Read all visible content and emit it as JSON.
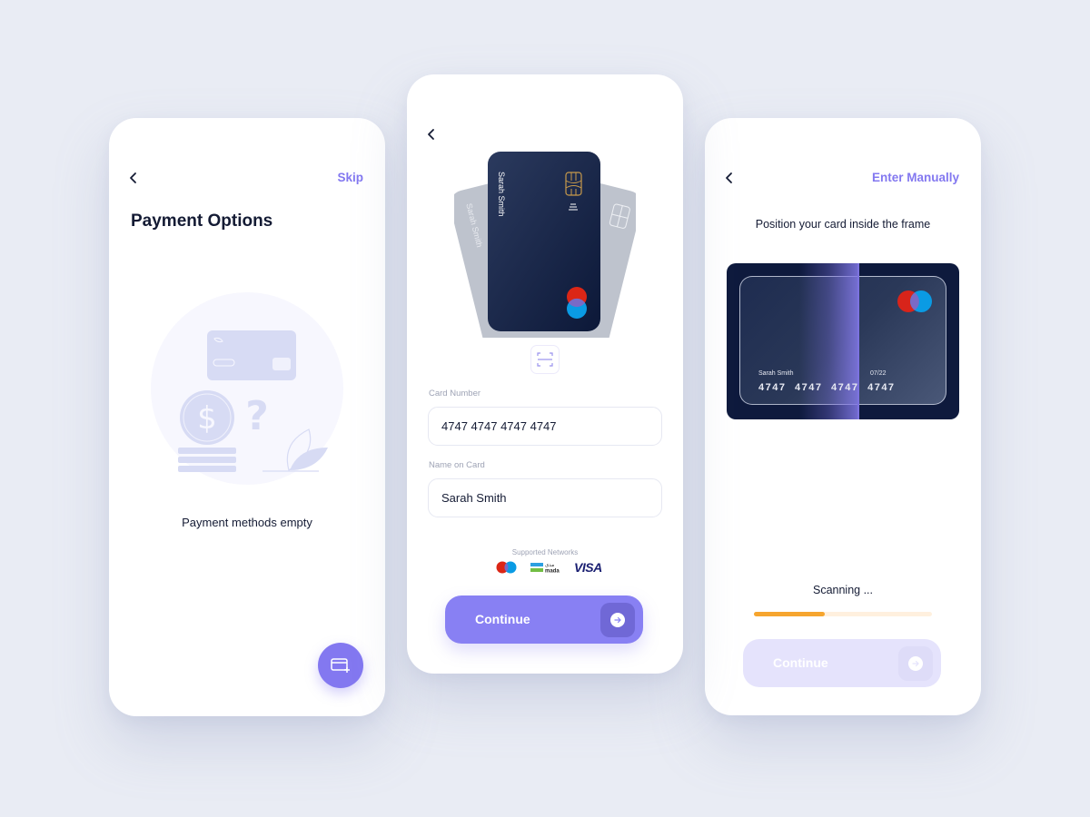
{
  "colors": {
    "background": "#E9ECF4",
    "accent": "#8378F0",
    "text_primary": "#141B34",
    "text_muted": "#9EA3B5",
    "progress": "#F6A52E",
    "card_navy": "#0E1A3D"
  },
  "screen1": {
    "back_icon": "chevron-left-icon",
    "skip_label": "Skip",
    "title": "Payment Options",
    "illustration": "empty-wallet-illustration",
    "empty_message": "Payment methods empty",
    "fab_icon": "add-card-icon"
  },
  "screen2": {
    "back_icon": "chevron-left-icon",
    "cards": [
      {
        "holder": "Sarah Smith",
        "style": "back-left"
      },
      {
        "holder": "Sarah Smith",
        "style": "front"
      },
      {
        "holder": "",
        "style": "back-right"
      }
    ],
    "scan_icon": "scan-card-icon",
    "card_number_label": "Card Number",
    "card_number_value": "4747  4747  4747  4747",
    "name_label": "Name on Card",
    "name_value": "Sarah Smith",
    "networks_label": "Supported Networks",
    "networks": [
      "Maestro",
      "mada",
      "VISA"
    ],
    "mada_arabic": "مدى",
    "continue_label": "Continue"
  },
  "screen3": {
    "back_icon": "chevron-left-icon",
    "enter_manually_label": "Enter Manually",
    "instruction": "Position your card inside the frame",
    "card_holder": "Sarah Smith",
    "card_expiry": "07/22",
    "card_number": "4747 4747 4747 4747",
    "scanning_label": "Scanning ...",
    "progress_percent": 40,
    "continue_label": "Continue",
    "continue_enabled": false
  }
}
